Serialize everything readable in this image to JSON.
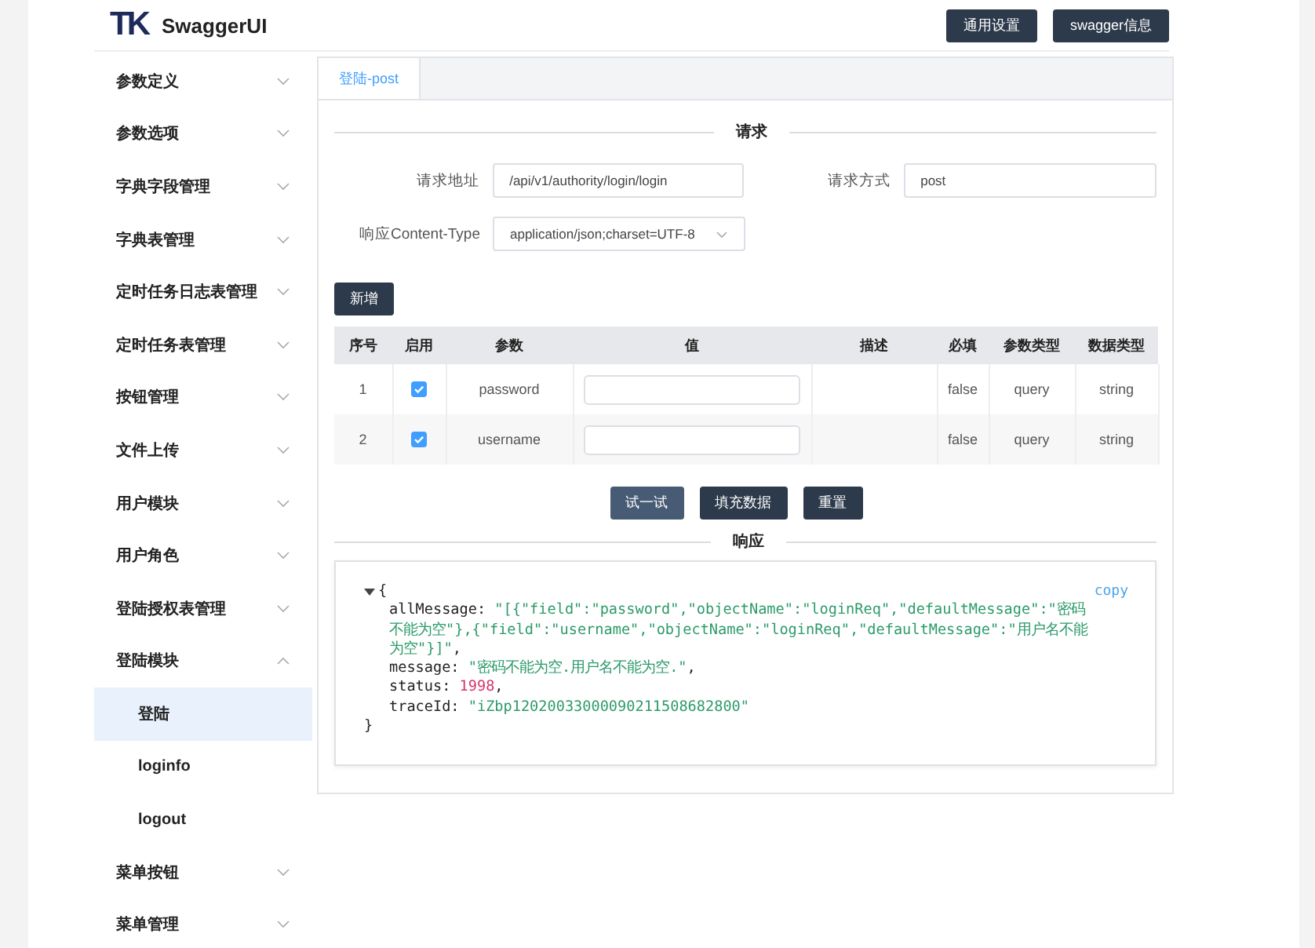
{
  "header": {
    "logo": "TK",
    "title": "SwaggerUI",
    "buttons": [
      "通用设置",
      "swagger信息"
    ]
  },
  "sidebar": {
    "items": [
      {
        "label": "参数定义",
        "expanded": false
      },
      {
        "label": "参数选项",
        "expanded": false
      },
      {
        "label": "字典字段管理",
        "expanded": false
      },
      {
        "label": "字典表管理",
        "expanded": false
      },
      {
        "label": "定时任务日志表管理",
        "expanded": false
      },
      {
        "label": "定时任务表管理",
        "expanded": false
      },
      {
        "label": "按钮管理",
        "expanded": false
      },
      {
        "label": "文件上传",
        "expanded": false
      },
      {
        "label": "用户模块",
        "expanded": false
      },
      {
        "label": "用户角色",
        "expanded": false
      },
      {
        "label": "登陆授权表管理",
        "expanded": false
      },
      {
        "label": "登陆模块",
        "expanded": true,
        "children": [
          {
            "label": "登陆",
            "selected": true
          },
          {
            "label": "loginfo",
            "selected": false
          },
          {
            "label": "logout",
            "selected": false
          }
        ]
      },
      {
        "label": "菜单按钮",
        "expanded": false
      },
      {
        "label": "菜单管理",
        "expanded": false
      }
    ]
  },
  "tabs": [
    {
      "label": "登陆-post",
      "selected": true
    }
  ],
  "request": {
    "title": "请求",
    "url_label": "请求地址",
    "url": "/api/v1/authority/login/login",
    "method_label": "请求方式",
    "method": "post",
    "content_type_label": "响应Content-Type",
    "content_type": "application/json;charset=UTF-8",
    "add_button": "新增"
  },
  "table": {
    "columns": [
      "序号",
      "启用",
      "参数",
      "值",
      "描述",
      "必填",
      "参数类型",
      "数据类型"
    ],
    "rows": [
      {
        "index": "1",
        "checked": true,
        "param": "password",
        "required": "false",
        "param_type": "query",
        "data_type": "string"
      },
      {
        "index": "2",
        "checked": true,
        "param": "username",
        "required": "false",
        "param_type": "query",
        "data_type": "string"
      }
    ]
  },
  "actions": [
    {
      "label": "试一试",
      "kind": "primary"
    },
    {
      "label": "填充数据",
      "kind": "dark"
    },
    {
      "label": "重置",
      "kind": "dark"
    }
  ],
  "response": {
    "title": "响应",
    "copy": "copy",
    "open": "{",
    "close": "}",
    "fields": [
      {
        "key": "allMessage:",
        "value": "\"[{\"field\":\"password\",\"objectName\":\"loginReq\",\"defaultMessage\":\"密码不能为空\"},{\"field\":\"username\",\"objectName\":\"loginReq\",\"defaultMessage\":\"用户名不能为空\"}]\"",
        "kind": "string",
        "trail": ","
      },
      {
        "key": "message:",
        "value": "\"密码不能为空.用户名不能为空.\"",
        "kind": "string",
        "trail": ","
      },
      {
        "key": "status:",
        "value": "1998",
        "kind": "number",
        "trail": ","
      },
      {
        "key": "traceId:",
        "value": "\"iZbp12020033000090211508682800\"",
        "kind": "string"
      }
    ]
  }
}
